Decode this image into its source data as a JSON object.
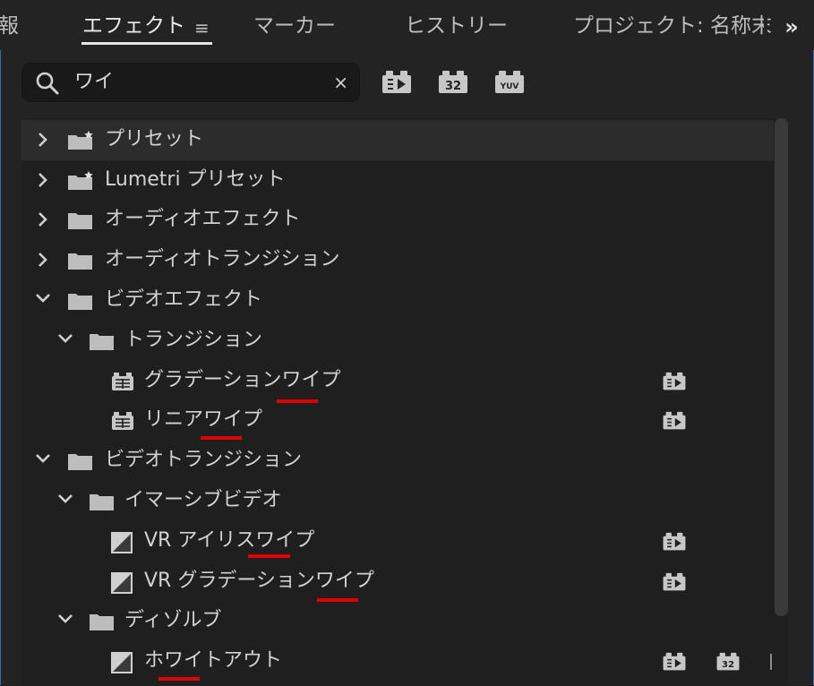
{
  "tabs": {
    "partial": "報",
    "effects": "エフェクト",
    "markers": "マーカー",
    "history": "ヒストリー",
    "project": "プロジェクト: 名称末"
  },
  "search": {
    "query": "ワイ",
    "clear_glyph": "×"
  },
  "filters": [
    "accelerated-effects",
    "32-bit-color",
    "yuv-effects"
  ],
  "filter_labels": {
    "b32": "32",
    "yuv": "YUV"
  },
  "tree": [
    {
      "label": "プリセット",
      "icon": "preset-folder-icon",
      "expanded": false,
      "selected": true
    },
    {
      "label": "Lumetri プリセット",
      "icon": "preset-folder-icon",
      "expanded": false
    },
    {
      "label": "オーディオエフェクト",
      "icon": "folder-icon",
      "expanded": false
    },
    {
      "label": "オーディオトランジション",
      "icon": "folder-icon",
      "expanded": false
    },
    {
      "label": "ビデオエフェクト",
      "icon": "folder-icon",
      "expanded": true
    },
    {
      "label": "トランジション",
      "icon": "folder-icon",
      "expanded": true
    },
    {
      "label": "グラデーションワイプ",
      "icon": "effect-icon",
      "badges": [
        "accelerated"
      ]
    },
    {
      "label": "リニアワイプ",
      "icon": "effect-icon",
      "badges": [
        "accelerated"
      ]
    },
    {
      "label": "ビデオトランジション",
      "icon": "folder-icon",
      "expanded": true
    },
    {
      "label": "イマーシブビデオ",
      "icon": "folder-icon",
      "expanded": true
    },
    {
      "label": "VR アイリスワイプ",
      "icon": "transition-icon",
      "badges": [
        "accelerated"
      ]
    },
    {
      "label": "VR グラデーションワイプ",
      "icon": "transition-icon",
      "badges": [
        "accelerated"
      ]
    },
    {
      "label": "ディゾルブ",
      "icon": "folder-icon",
      "expanded": true
    },
    {
      "label": "ホワイトアウト",
      "icon": "transition-icon",
      "badges": [
        "accelerated",
        "32-bit"
      ]
    }
  ],
  "colors": {
    "highlight_underline": "#e00000",
    "panel_border": "#2f6db8"
  }
}
